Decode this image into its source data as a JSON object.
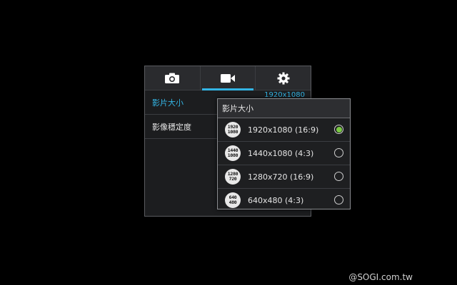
{
  "tabs": [
    {
      "label": "",
      "icon": "camera-icon",
      "active": false
    },
    {
      "label": "",
      "icon": "video-camera-icon",
      "active": true
    },
    {
      "label": "",
      "icon": "gear-icon",
      "active": false
    }
  ],
  "settings": {
    "rows": [
      {
        "label": "影片大小",
        "value": "1920x1080",
        "selected": true
      },
      {
        "label": "影像穩定度",
        "value": "",
        "selected": false
      }
    ]
  },
  "popup": {
    "title": "影片大小",
    "options": [
      {
        "label": "1920x1080 (16:9)",
        "icon_lines": [
          "1920",
          "1080"
        ],
        "checked": true
      },
      {
        "label": "1440x1080 (4:3)",
        "icon_lines": [
          "1440",
          "1080"
        ],
        "checked": false
      },
      {
        "label": "1280x720 (16:9)",
        "icon_lines": [
          "1280",
          "720"
        ],
        "checked": false
      },
      {
        "label": "640x480 (4:3)",
        "icon_lines": [
          "640",
          "480"
        ],
        "checked": false
      }
    ]
  },
  "watermark": "@SOGI.com.tw",
  "colors": {
    "accent": "#33b5e5",
    "radio_checked": "#7ac943",
    "background": "#000000"
  }
}
